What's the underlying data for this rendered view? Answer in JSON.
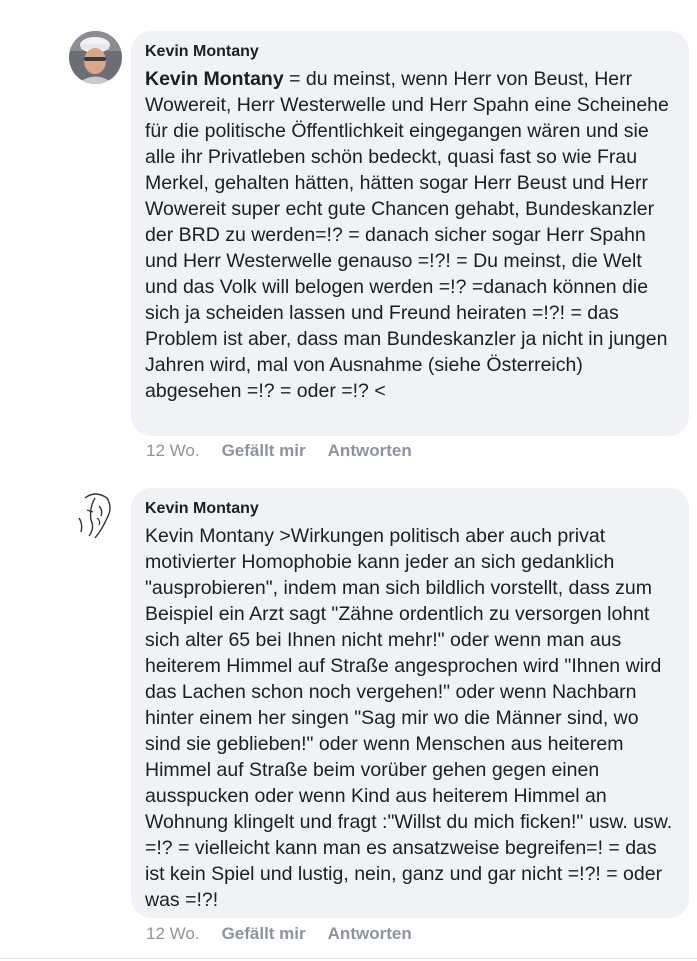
{
  "comments": [
    {
      "author": "Kevin Montany",
      "mention": "Kevin Montany",
      "body": " = du meinst, wenn Herr von Beust, Herr Wowereit, Herr Westerwelle und Herr Spahn eine Scheinehe für die politische Öffentlichkeit eingegangen wären und sie alle ihr Privatleben schön bedeckt, quasi fast so wie Frau Merkel, gehalten hätten, hätten sogar Herr Beust und Herr Wowereit super echt gute Chancen gehabt, Bundeskanzler der BRD zu werden=!? = danach sicher sogar Herr Spahn und Herr Westerwelle genauso =!?! = Du meinst, die Welt und das Volk will belogen werden =!? =danach können die sich ja scheiden lassen und Freund heiraten =!?! = das Problem ist aber, dass man Bundeskanzler ja nicht in jungen Jahren wird, mal von Ausnahme (siehe Österreich) abgesehen =!? = oder =!? <",
      "time": "12 Wo.",
      "like_label": "Gefällt mir",
      "reply_label": "Antworten"
    },
    {
      "author": "Kevin Montany",
      "body": "Kevin Montany >Wirkungen politisch aber auch privat motivierter Homophobie kann jeder an sich gedanklich \"ausprobieren\", indem man sich bildlich vorstellt, dass zum Beispiel ein Arzt sagt \"Zähne ordentlich zu versorgen lohnt sich alter 65 bei Ihnen nicht mehr!\" oder wenn man aus heiterem Himmel auf Straße angesprochen wird \"Ihnen wird das Lachen schon noch vergehen!\" oder wenn Nachbarn hinter einem her singen \"Sag mir wo die Männer sind, wo sind sie geblieben!\" oder wenn Menschen aus heiterem Himmel auf Straße beim vorüber gehen gegen einen ausspucken oder wenn Kind aus heiterem Himmel an Wohnung klingelt und fragt :\"Willst du mich ficken!\" usw. usw. =!? = vielleicht kann man es ansatzweise begreifen=! = das ist kein Spiel und lustig, nein, ganz und gar nicht =!?! = oder was =!?!",
      "time": "12 Wo.",
      "like_label": "Gefällt mir",
      "reply_label": "Antworten"
    }
  ]
}
